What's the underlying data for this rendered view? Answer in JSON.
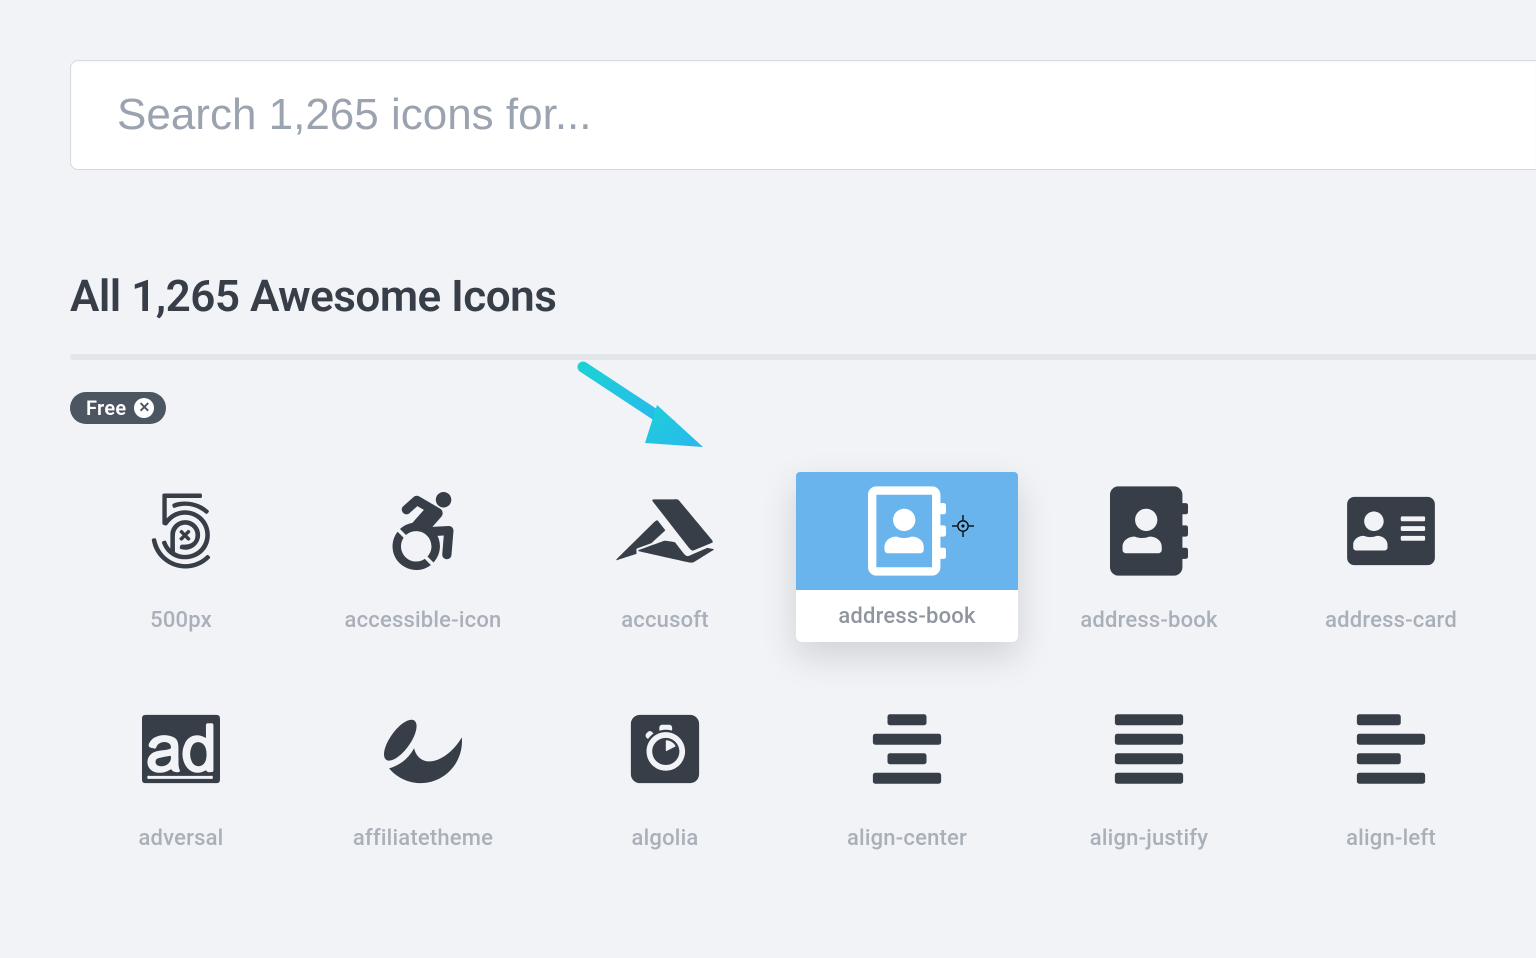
{
  "search": {
    "placeholder": "Search 1,265 icons for...",
    "value": ""
  },
  "heading": "All 1,265 Awesome Icons",
  "filter": {
    "label": "Free",
    "close_glyph": "✕"
  },
  "selected_index": 3,
  "icons": [
    {
      "label": "500px"
    },
    {
      "label": "accessible-icon"
    },
    {
      "label": "accusoft"
    },
    {
      "label": "address-book"
    },
    {
      "label": "address-book"
    },
    {
      "label": "address-card"
    },
    {
      "label": "adversal"
    },
    {
      "label": "affiliatetheme"
    },
    {
      "label": "algolia"
    },
    {
      "label": "align-center"
    },
    {
      "label": "align-justify"
    },
    {
      "label": "align-left"
    }
  ]
}
